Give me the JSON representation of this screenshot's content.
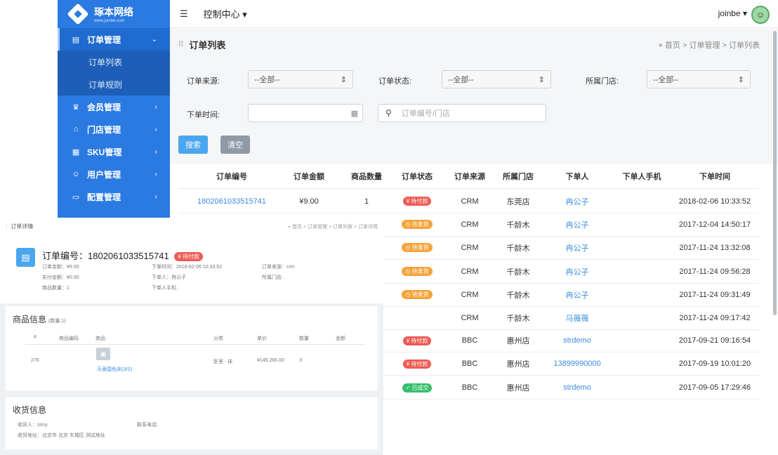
{
  "brand": {
    "name": "琢本网络",
    "url": "www.joinbe.com"
  },
  "sidebar": {
    "items": [
      {
        "label": "订单管理",
        "icon": "clipboard-icon",
        "arrow": "⌄",
        "active": true,
        "children": [
          {
            "label": "订单列表"
          },
          {
            "label": "订单规则"
          }
        ]
      },
      {
        "label": "会员管理",
        "icon": "crown-icon",
        "arrow": "›"
      },
      {
        "label": "门店管理",
        "icon": "store-icon",
        "arrow": "›"
      },
      {
        "label": "SKU管理",
        "icon": "grid-icon",
        "arrow": "›"
      },
      {
        "label": "用户管理",
        "icon": "user-icon",
        "arrow": "›"
      },
      {
        "label": "配置管理",
        "icon": "monitor-icon",
        "arrow": "›"
      }
    ]
  },
  "topbar": {
    "control_label": "控制中心 ▾",
    "user": "joinbe ▾"
  },
  "page": {
    "title": "订单列表",
    "breadcrumb": "首页 >  订单管理 >  订单列表"
  },
  "filters": {
    "source_label": "订单来源:",
    "source_value": "--全部--",
    "status_label": "订单状态:",
    "status_value": "--全部--",
    "store_label": "所属门店:",
    "store_value": "--全部--",
    "time_label": "下单时间:",
    "search_placeholder": "订单编号/门店",
    "search_button": "搜索",
    "clear_button": "清空"
  },
  "order_table": {
    "headers": [
      "订单编号",
      "订单金额",
      "商品数量",
      "订单状态",
      "订单来源",
      "所属门店",
      "下单人",
      "下单人手机",
      "下单时间"
    ],
    "rows": [
      {
        "id": "1802061033515741",
        "amount": "¥9.00",
        "qty": "1",
        "status": "¥ 待付款",
        "status_color": "#ee5b52",
        "source": "CRM",
        "store": "东莞店",
        "buyer": "冉公子",
        "phone": "",
        "time": "2018-02-06 10:33:52"
      },
      {
        "id": "",
        "amount": "",
        "qty": "",
        "status": "◷ 待发货",
        "status_color": "#f5a33a",
        "source": "CRM",
        "store": "千龄木",
        "buyer": "冉公子",
        "phone": "",
        "time": "2017-12-04 14:50:17"
      },
      {
        "id": "",
        "amount": "",
        "qty": "",
        "status": "◷ 待发货",
        "status_color": "#f5a33a",
        "source": "CRM",
        "store": "千龄木",
        "buyer": "冉公子",
        "phone": "",
        "time": "2017-11-24 13:32:08"
      },
      {
        "id": "",
        "amount": "",
        "qty": "",
        "status": "◷ 待发货",
        "status_color": "#f5a33a",
        "source": "CRM",
        "store": "千龄木",
        "buyer": "冉公子",
        "phone": "",
        "time": "2017-11-24 09:56:28"
      },
      {
        "id": "",
        "amount": "",
        "qty": "",
        "status": "◷ 待发货",
        "status_color": "#f5a33a",
        "source": "CRM",
        "store": "千龄木",
        "buyer": "冉公子",
        "phone": "",
        "time": "2017-11-24 09:31:49"
      },
      {
        "id": "",
        "amount": "",
        "qty": "",
        "status": "",
        "status_color": "",
        "source": "CRM",
        "store": "千龄木",
        "buyer": "马薇薇",
        "phone": "",
        "time": "2017-11-24 09:17:42"
      },
      {
        "id": "",
        "amount": "",
        "qty": "",
        "status": "¥ 待付款",
        "status_color": "#ee5b52",
        "source": "BBC",
        "store": "惠州店",
        "buyer": "strdemo",
        "phone": "",
        "time": "2017-09-21 09:16:54"
      },
      {
        "id": "",
        "amount": "",
        "qty": "",
        "status": "¥ 待付款",
        "status_color": "#ee5b52",
        "source": "BBC",
        "store": "惠州店",
        "buyer": "13899990000",
        "phone": "",
        "time": "2017-09-19 10:01:20"
      },
      {
        "id": "",
        "amount": "",
        "qty": "",
        "status": "✓ 已成交",
        "status_color": "#35c06a",
        "source": "BBC",
        "store": "惠州店",
        "buyer": "strdemo",
        "phone": "",
        "time": "2017-09-05 17:29:46"
      }
    ]
  },
  "detail": {
    "head_title": "订单详情",
    "breadcrumb": "首页 >  订单管理 >  订单列表 >  订单详情",
    "order_title": "订单编号：1802061033515741",
    "status_badge": "¥ 待付款",
    "order_amount": "订单金额：¥9.00",
    "paid_amount": "实付金额：¥0.00",
    "goods_count": "商品数量：1",
    "order_time": "下单时间：2018-02-06 10:33:52",
    "buyer": "下单人：冉公子",
    "buyer_phone": "下单人手机:",
    "source": "订单来源：crm",
    "store": "所属门店:",
    "goods_title": "商品信息",
    "goods_count_note": "(数量:1)",
    "goods_headers": [
      "#",
      "商品编码",
      "商品",
      "分类",
      "单价",
      "数量",
      "金额"
    ],
    "goods_row": {
      "no": "276",
      "code": "",
      "name": "天香国色床(3/S)",
      "category": "卧室 - 床",
      "price": "¥145,266.00",
      "qty": "X",
      "amount": ""
    },
    "ship_title": "收货信息",
    "receiver": "收货人：sony",
    "contact": "联系电话:",
    "address": "收货地址：北京市 北京 东城区 测试地址"
  }
}
